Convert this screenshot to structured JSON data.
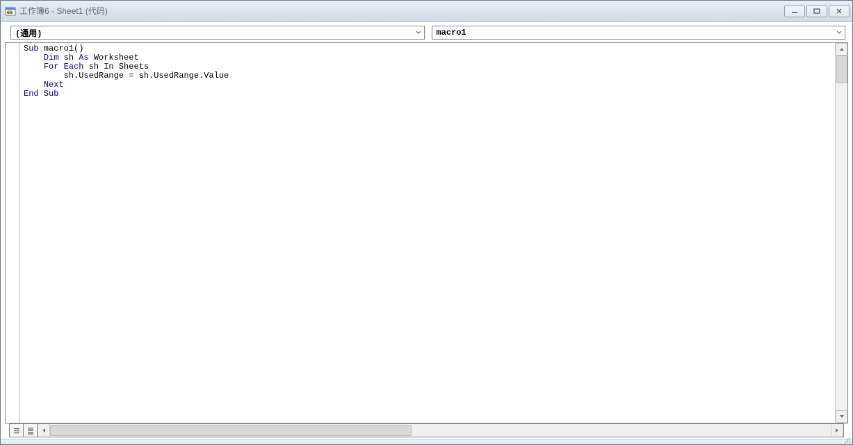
{
  "window": {
    "title": "工作簿6 - Sheet1 (代码)"
  },
  "dropdowns": {
    "object_selected": "(通用)",
    "procedure_selected": "macro1"
  },
  "code": {
    "lines": [
      {
        "indent": 0,
        "tokens": [
          {
            "t": "Sub",
            "kw": true
          },
          {
            "t": " macro1()",
            "kw": false
          }
        ]
      },
      {
        "indent": 1,
        "tokens": [
          {
            "t": "Dim",
            "kw": true
          },
          {
            "t": " sh ",
            "kw": false
          },
          {
            "t": "As",
            "kw": true
          },
          {
            "t": " Worksheet",
            "kw": false
          }
        ]
      },
      {
        "indent": 1,
        "tokens": [
          {
            "t": "For Each",
            "kw": true
          },
          {
            "t": " sh ",
            "kw": false
          },
          {
            "t": "In",
            "kw": true
          },
          {
            "t": " Sheets",
            "kw": false
          }
        ]
      },
      {
        "indent": 2,
        "tokens": [
          {
            "t": "sh.UsedRange = sh.UsedRange.Value",
            "kw": false
          }
        ]
      },
      {
        "indent": 1,
        "tokens": [
          {
            "t": "Next",
            "kw": true
          }
        ]
      },
      {
        "indent": 0,
        "tokens": [
          {
            "t": "End Sub",
            "kw": true
          }
        ]
      }
    ]
  }
}
